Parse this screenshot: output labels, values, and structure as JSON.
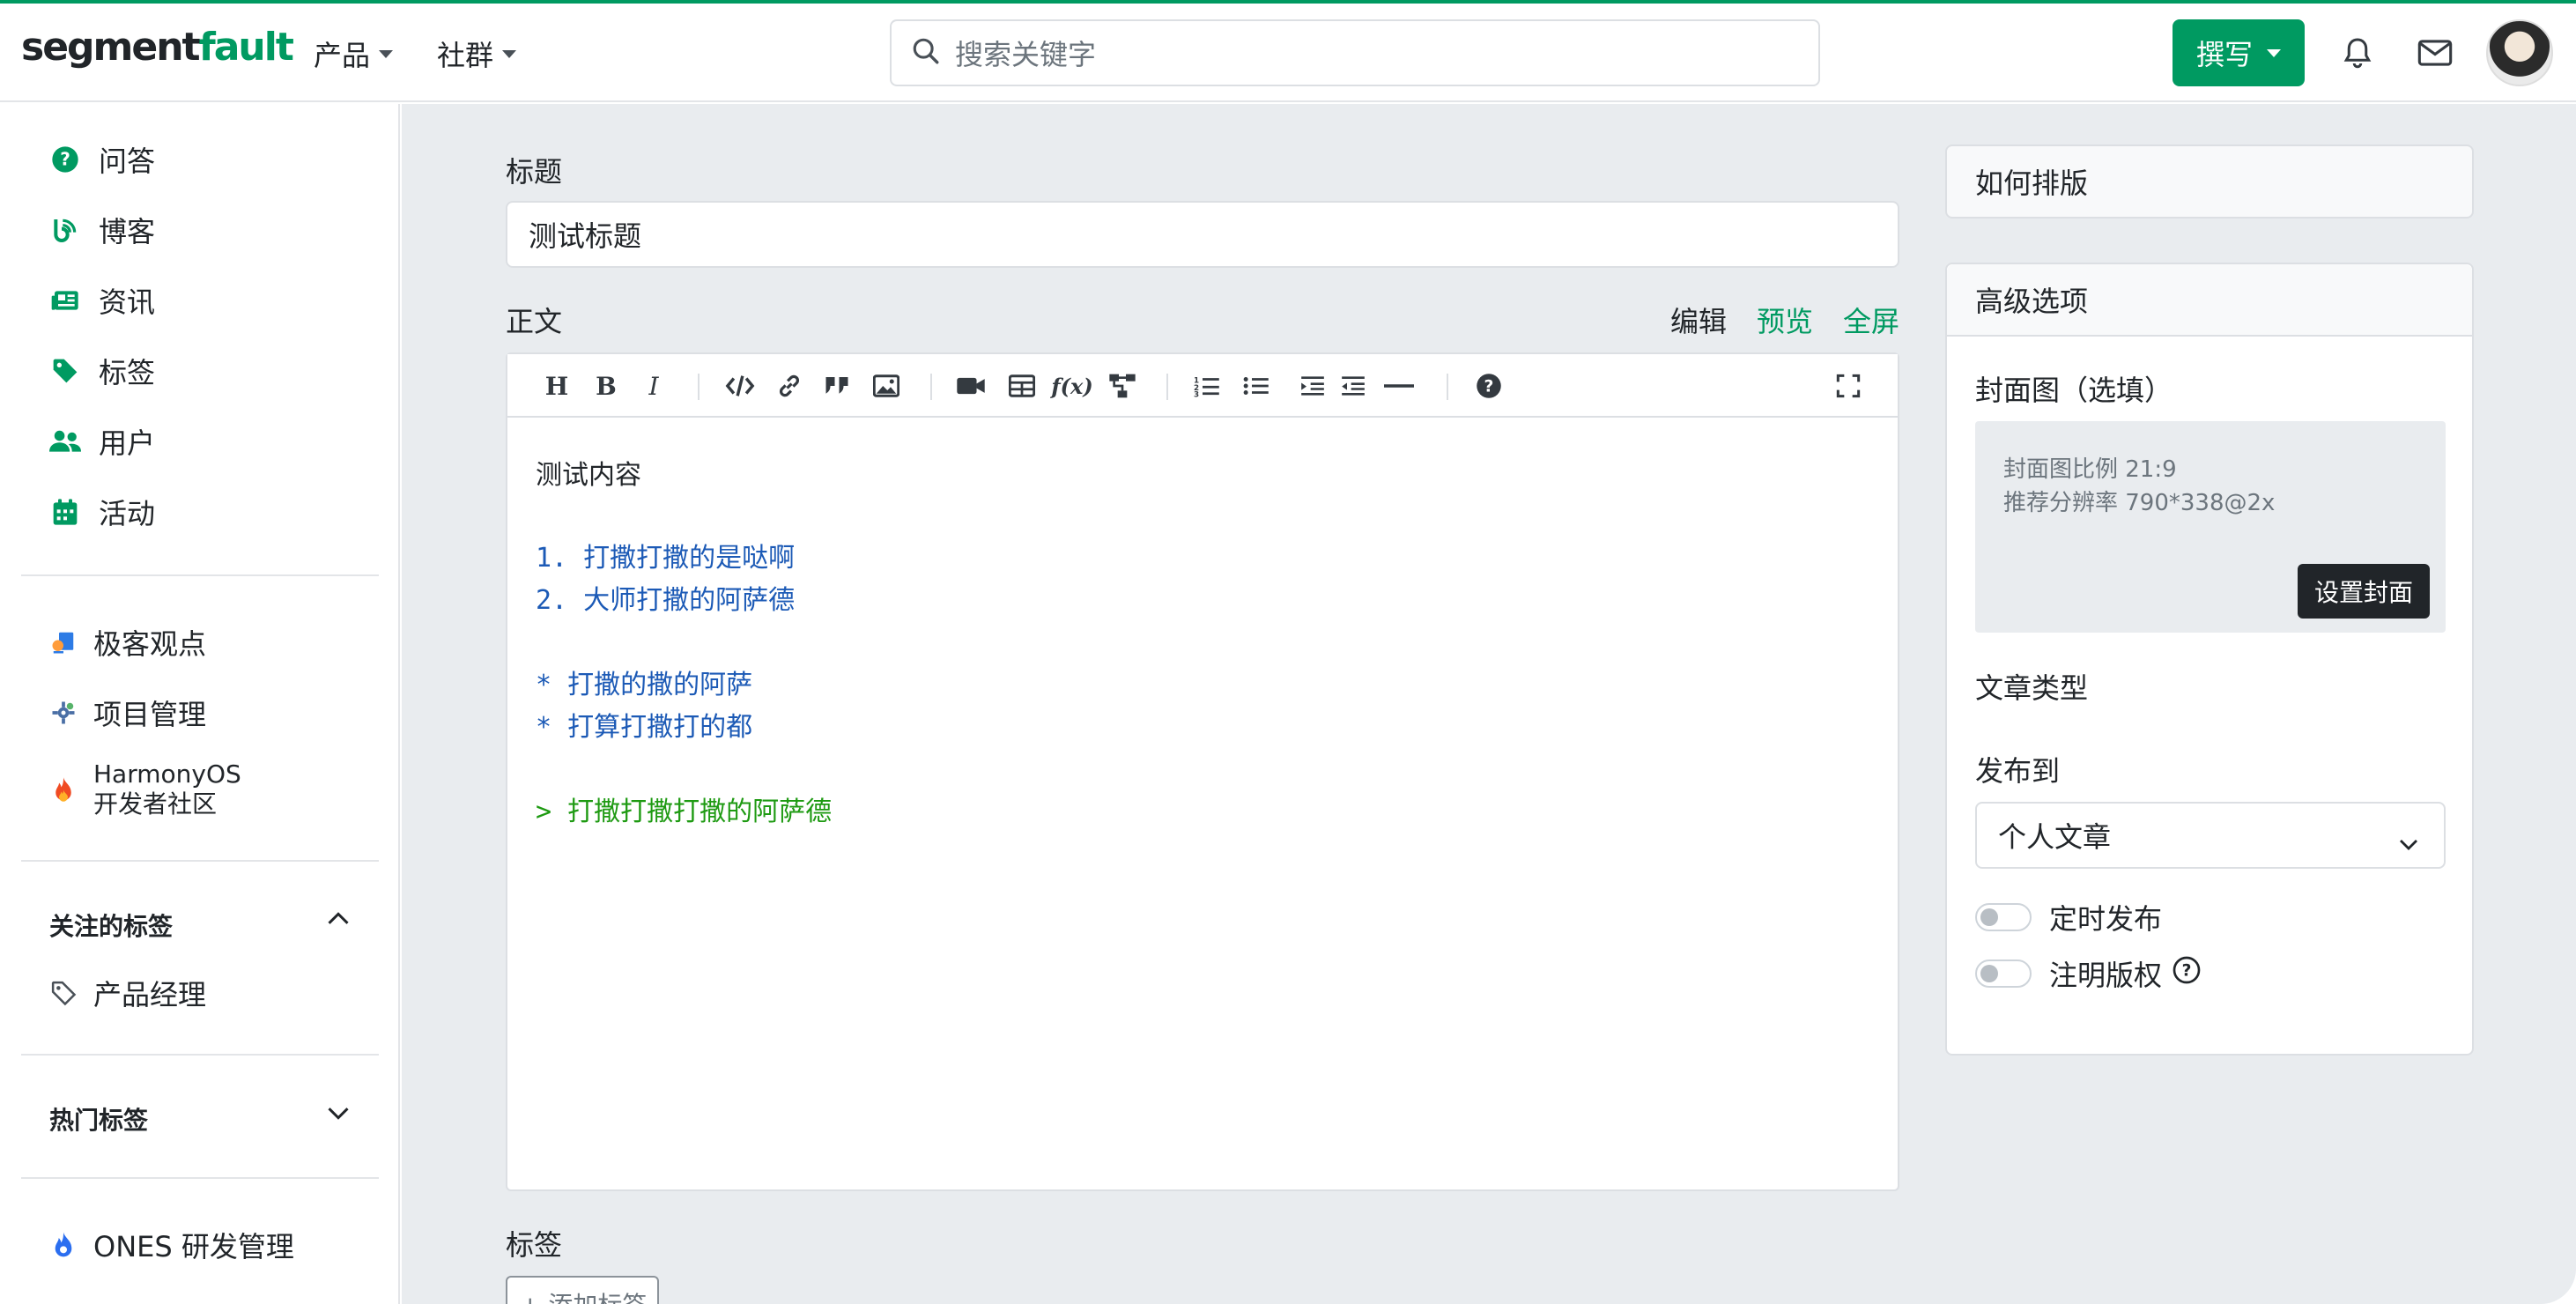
{
  "header": {
    "logo_part1": "segment",
    "logo_part2": "fault",
    "nav": [
      {
        "label": "产品"
      },
      {
        "label": "社群"
      }
    ],
    "search_placeholder": "搜索关键字",
    "write_label": "撰写"
  },
  "sidebar": {
    "main_items": [
      {
        "label": "问答",
        "icon": "question-circle-icon"
      },
      {
        "label": "博客",
        "icon": "blog-icon"
      },
      {
        "label": "资讯",
        "icon": "newspaper-icon"
      },
      {
        "label": "标签",
        "icon": "tags-icon"
      },
      {
        "label": "用户",
        "icon": "users-icon"
      },
      {
        "label": "活动",
        "icon": "calendar-icon"
      }
    ],
    "promo_items": [
      {
        "label": "极客观点",
        "icon": "geek-icon"
      },
      {
        "label": "项目管理",
        "icon": "project-icon"
      },
      {
        "label_line1": "HarmonyOS",
        "label_line2": "开发者社区",
        "icon": "fire-icon"
      }
    ],
    "followed_tags_title": "关注的标签",
    "followed_tags": [
      {
        "label": "产品经理"
      }
    ],
    "hot_tags_title": "热门标签",
    "bottom_item": {
      "label": "ONES 研发管理",
      "icon": "ones-icon"
    }
  },
  "editor": {
    "title_label": "标题",
    "title_value": "测试标题",
    "body_label": "正文",
    "modes": {
      "edit": "编辑",
      "preview": "预览",
      "fullscreen": "全屏"
    },
    "lines": {
      "l1": "测试内容",
      "l2": "1. 打撒打撒的是哒啊",
      "l3": "2. 大师打撒的阿萨德",
      "l4": "* 打撒的撒的阿萨",
      "l5": "* 打算打撒打的都",
      "l6": "> 打撒打撒打撒的阿萨德"
    },
    "tags_label": "标签",
    "add_tag": "+ 添加标签"
  },
  "right": {
    "how_to_format": "如何排版",
    "advanced_options": "高级选项",
    "cover_label": "封面图（选填）",
    "cover_ratio": "封面图比例 21:9",
    "cover_resolution": "推荐分辨率 790*338@2x",
    "cover_button": "设置封面",
    "article_type_label": "文章类型",
    "publish_to_label": "发布到",
    "publish_to_value": "个人文章",
    "scheduled_label": "定时发布",
    "copyright_label": "注明版权"
  },
  "colors": {
    "brand": "#009a61",
    "blue_text": "#1c5ab6",
    "green_text": "#1e9a12"
  }
}
